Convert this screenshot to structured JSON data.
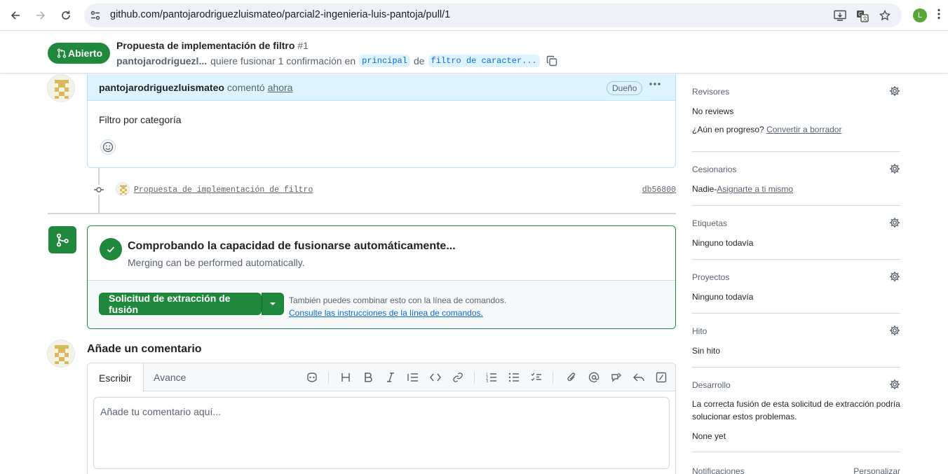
{
  "browser": {
    "url": "github.com/pantojarodriguezluismateo/parcial2-ingenieria-luis-pantoja/pull/1",
    "profile_initial": "L"
  },
  "pr": {
    "state": "Abierto",
    "title": "Propuesta de implementación de filtro",
    "number": "#1",
    "author_short": "pantojarodriguezl...",
    "merge_phrase": "quiere fusionar 1 confirmación en",
    "base_branch": "principal",
    "from_word": "de",
    "head_branch": "filtro de caracter..."
  },
  "comment": {
    "author": "pantojarodriguezluismateo",
    "verb": "comentó",
    "time": "ahora",
    "badge": "Dueño",
    "body": "Filtro por categoría"
  },
  "commit": {
    "message": "Propuesta de implementación de filtro",
    "sha": "db56800"
  },
  "merge": {
    "title": "Comprobando la capacidad de fusionarse automáticamente...",
    "description": "Merging can be performed automatically.",
    "button": "Solicitud de extracción de fusión",
    "hint": "También puedes combinar esto con la línea de comandos.",
    "hint_link": "Consulte las instrucciones de la línea de comandos."
  },
  "add_comment": {
    "title": "Añade un comentario",
    "tab_write": "Escribir",
    "tab_preview": "Avance",
    "placeholder": "Añade tu comentario aquí..."
  },
  "sidebar": {
    "reviewers": {
      "title": "Revisores",
      "value": "No reviews",
      "progress_q": "¿Aún en progreso?",
      "progress_link": "Convertir a borrador"
    },
    "assignees": {
      "title": "Cesionarios",
      "value": "Nadie-",
      "link": "Asignarte a ti mismo"
    },
    "labels": {
      "title": "Etiquetas",
      "value": "Ninguno todavía"
    },
    "projects": {
      "title": "Proyectos",
      "value": "Ninguno todavía"
    },
    "milestone": {
      "title": "Hito",
      "value": "Sin hito"
    },
    "development": {
      "title": "Desarrollo",
      "line1": "La correcta fusión de esta solicitud de extracción podría",
      "line2": "solucionar estos problemas.",
      "value": "None yet"
    },
    "notifications": {
      "title": "Notificaciones",
      "action": "Personalizar"
    }
  },
  "colors": {
    "accent_green": "#1f883d",
    "link_blue": "#0969da",
    "comment_header": "#ddf4ff"
  }
}
